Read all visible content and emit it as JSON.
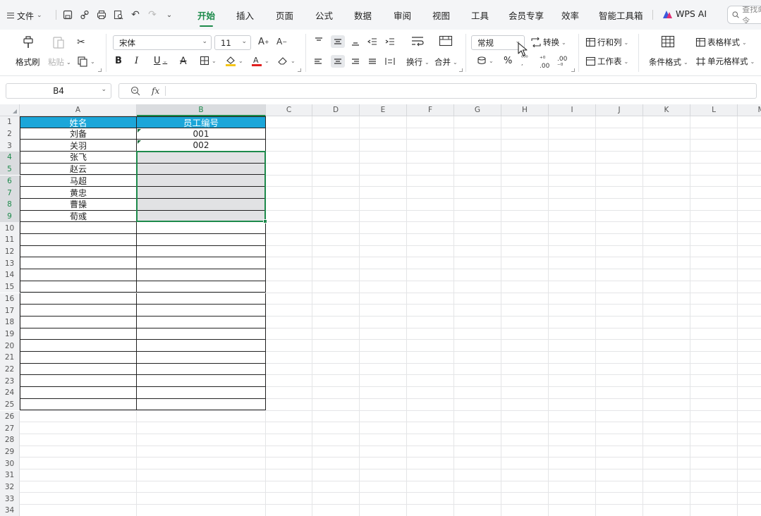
{
  "menubar": {
    "file_label": "文件",
    "tabs": [
      {
        "label": "开始",
        "active": true
      },
      {
        "label": "插入",
        "active": false
      },
      {
        "label": "页面",
        "active": false
      },
      {
        "label": "公式",
        "active": false
      },
      {
        "label": "数据",
        "active": false
      },
      {
        "label": "审阅",
        "active": false
      },
      {
        "label": "视图",
        "active": false
      },
      {
        "label": "工具",
        "active": false
      },
      {
        "label": "会员专享",
        "active": false
      },
      {
        "label": "效率",
        "active": false
      },
      {
        "label": "智能工具箱",
        "active": false
      }
    ],
    "ai_label": "WPS AI",
    "search_placeholder": "查找命令"
  },
  "ribbon": {
    "format_painter": "格式刷",
    "paste": "粘贴",
    "font_name": "宋体",
    "font_size": "11",
    "bold": "B",
    "italic": "I",
    "underline": "U",
    "wrap": "换行",
    "merge": "合并",
    "number_format": "常规",
    "convert": "转换",
    "percent": "%",
    "rows_cols": "行和列",
    "worksheet": "工作表",
    "table_style": "表格样式",
    "cond_format": "条件格式",
    "cell_style": "单元格样式"
  },
  "formula_bar": {
    "name_box": "B4",
    "fx_label": "fx",
    "formula": ""
  },
  "columns": [
    "A",
    "B",
    "C",
    "D",
    "E",
    "F",
    "G",
    "H",
    "I",
    "J",
    "K",
    "L",
    "M"
  ],
  "rows": [
    "1",
    "2",
    "3",
    "4",
    "5",
    "6",
    "7",
    "8",
    "9",
    "10",
    "11",
    "12",
    "13",
    "14",
    "15",
    "16",
    "17",
    "18",
    "19",
    "20",
    "21",
    "22",
    "23",
    "24",
    "25",
    "26",
    "27",
    "28",
    "29",
    "30",
    "31",
    "32",
    "33",
    "34"
  ],
  "sheet": {
    "header": {
      "a": "姓名",
      "b": "员工编号"
    },
    "data": [
      {
        "a": "刘备",
        "b": "001"
      },
      {
        "a": "关羽",
        "b": "002"
      },
      {
        "a": "张飞",
        "b": ""
      },
      {
        "a": "赵云",
        "b": ""
      },
      {
        "a": "马超",
        "b": ""
      },
      {
        "a": "黄忠",
        "b": ""
      },
      {
        "a": "曹操",
        "b": ""
      },
      {
        "a": "荀彧",
        "b": ""
      }
    ],
    "header_color": "#1ba6d9",
    "selected_range": "B4:B9",
    "selection_color": "#1d8a4b"
  }
}
